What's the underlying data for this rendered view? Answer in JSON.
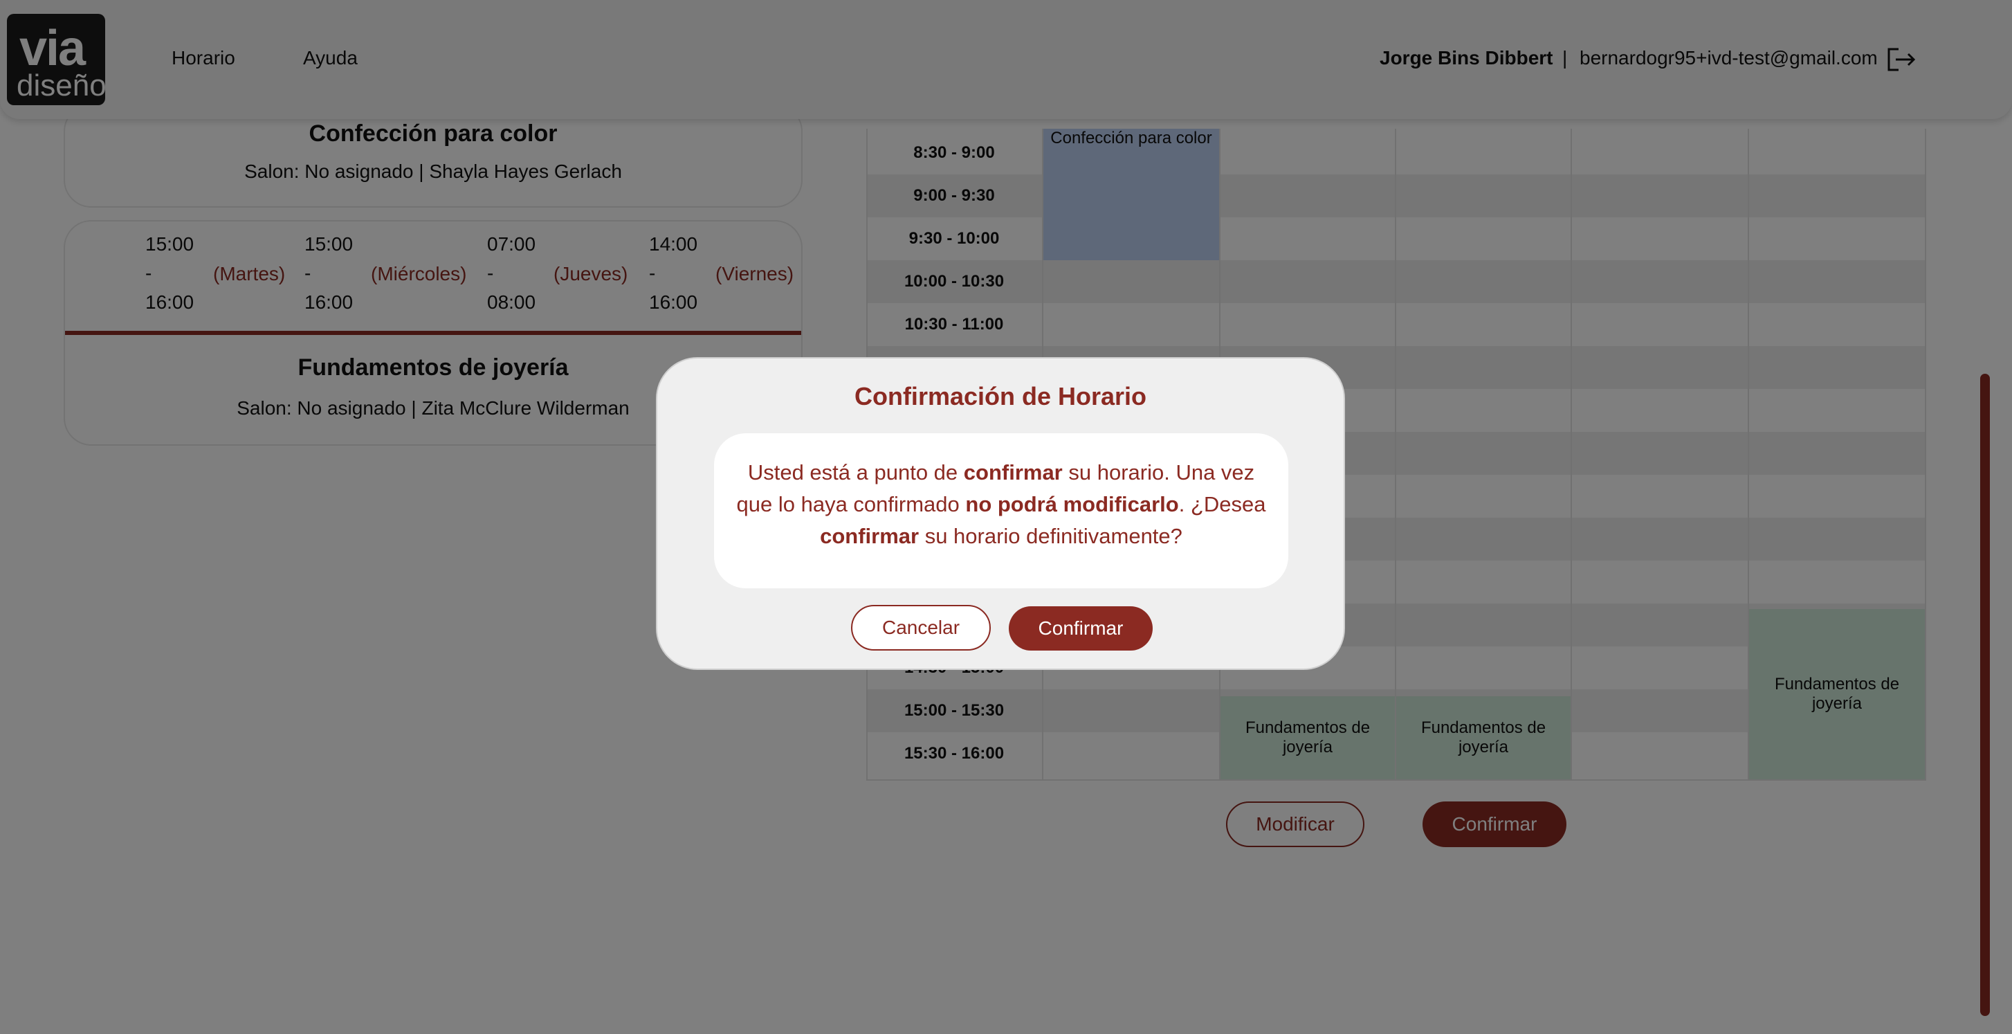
{
  "header": {
    "logo_top": "via",
    "logo_bottom": "diseño",
    "nav": [
      "Horario",
      "Ayuda"
    ],
    "user_name": "Jorge Bins Dibbert",
    "separator": "|",
    "user_email": "bernardogr95+ivd-test@gmail.com"
  },
  "courses": [
    {
      "title": "Confección para color",
      "subtitle": "Salon: No asignado | Shayla Hayes Gerlach",
      "slots": [
        {
          "start": "15:00",
          "dash": "-",
          "end": "16:00",
          "day": "(Martes)"
        },
        {
          "start": "15:00",
          "dash": "-",
          "end": "16:00",
          "day": "(Miércoles)"
        },
        {
          "start": "07:00",
          "dash": "-",
          "end": "08:00",
          "day": "(Jueves)"
        },
        {
          "start": "14:00",
          "dash": "-",
          "end": "16:00",
          "day": "(Viernes)"
        }
      ]
    },
    {
      "title": "Fundamentos de joyería",
      "subtitle": "Salon: No asignado | Zita McClure Wilderman"
    }
  ],
  "schedule": {
    "times": [
      "8:30 - 9:00",
      "9:00 - 9:30",
      "9:30 - 10:00",
      "10:00 - 10:30",
      "10:30 - 11:00",
      "",
      "",
      "",
      "",
      "",
      "",
      "",
      "14:30 - 15:00",
      "15:00 - 15:30",
      "15:30 - 16:00"
    ],
    "events": [
      {
        "label": "Confección para color",
        "color": "#bcd1f3"
      },
      {
        "label": "Fundamentos de joyería",
        "color": "#cfe8d8"
      },
      {
        "label": "Fundamentos de joyería",
        "color": "#cfe8d8"
      },
      {
        "label": "Fundamentos de joyería",
        "color": "#cfe8d8"
      }
    ]
  },
  "actions": {
    "modify": "Modificar",
    "confirm": "Confirmar"
  },
  "modal": {
    "title": "Confirmación de Horario",
    "text": {
      "p1": "Usted está a punto de ",
      "b1": "confirmar",
      "p2": " su horario. Una vez que lo haya confirmado ",
      "b2": "no podrá modificarlo",
      "p3": ". ¿Desea ",
      "b3": "confirmar",
      "p4": " su horario definitivamente?"
    },
    "cancel": "Cancelar",
    "confirm": "Confirmar"
  },
  "colors": {
    "accent": "#8b2a22",
    "event_blue": "#bcd1f3",
    "event_green": "#cfe8d8"
  },
  "icons": {
    "logout": "logout-icon"
  }
}
